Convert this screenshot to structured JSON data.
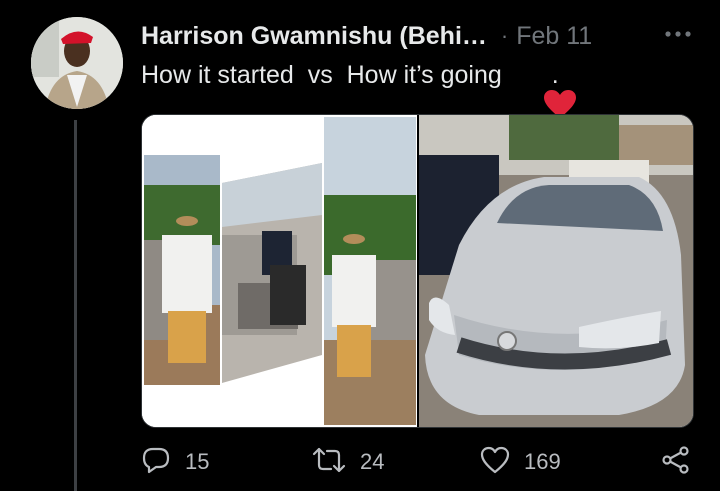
{
  "tweet": {
    "display_name": "Harrison Gwamnishu (Behi…",
    "separator": "·",
    "date": "Feb 11",
    "text_before_emoji": "How it started  vs  How it’s going ",
    "emoji": "red-heart",
    "text_after_emoji": "."
  },
  "actions": {
    "reply_count": "15",
    "retweet_count": "24",
    "like_count": "169"
  },
  "colors": {
    "background": "#000000",
    "primary_text": "#e7e9ea",
    "secondary_text": "#71767b",
    "heart": "#f91880"
  }
}
